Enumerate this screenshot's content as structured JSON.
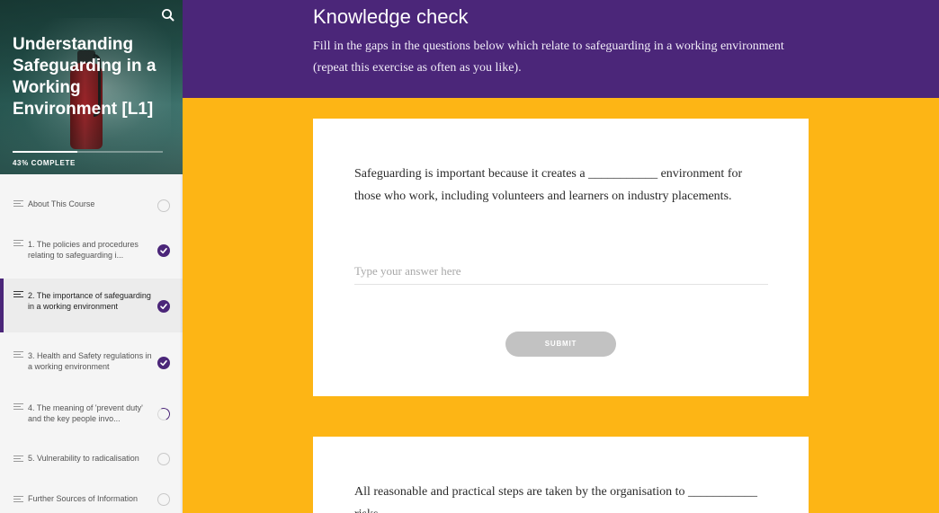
{
  "sidebar": {
    "search_icon": "search-icon",
    "course_title": "Understanding Safeguarding in a Working Environment [L1]",
    "progress_percent": 43,
    "progress_label": "43% COMPLETE",
    "items": [
      {
        "label": "About This Course",
        "status": "not-started"
      },
      {
        "label": "1. The policies and procedures relating to safeguarding i...",
        "status": "complete"
      },
      {
        "label": "2. The importance of safeguarding in a working environment",
        "status": "complete",
        "active": true
      },
      {
        "label": "3. Health and Safety regulations in a working environment",
        "status": "complete"
      },
      {
        "label": "4. The meaning of 'prevent duty' and the key people invo...",
        "status": "in-progress"
      },
      {
        "label": "5. Vulnerability to radicalisation",
        "status": "not-started"
      },
      {
        "label": "Further Sources of Information",
        "status": "not-started"
      }
    ]
  },
  "main": {
    "title": "Knowledge check",
    "subtitle": "Fill in the gaps in the questions below which relate to safeguarding in a working environment (repeat this exercise as often as you like).",
    "questions": [
      {
        "text": "Safeguarding is important because it creates a ___________ environment for those who work, including volunteers and learners on industry placements.",
        "placeholder": "Type your answer here",
        "submit_label": "SUBMIT"
      },
      {
        "text": "All reasonable and practical steps are taken by the organisation to ___________ risks."
      }
    ]
  },
  "colors": {
    "purple": "#4b2679",
    "yellow": "#FDB515",
    "submit_disabled": "#c2c2c2"
  }
}
